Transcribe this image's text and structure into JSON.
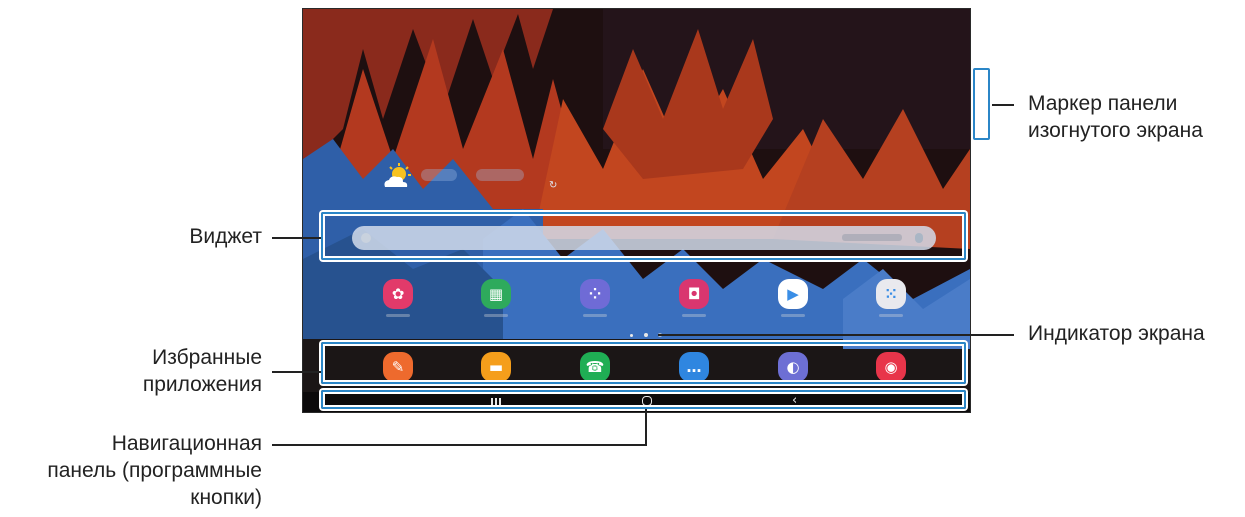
{
  "callouts": {
    "edge_handle": [
      "Маркер панели",
      "изогнутого экрана"
    ],
    "widget": "Виджет",
    "favorites": [
      "Избранные",
      "приложения"
    ],
    "page_indicator": "Индикатор экрана",
    "navbar": [
      "Навигационная",
      "панель (программные",
      "кнопки)"
    ]
  },
  "screen": {
    "weather_icon": "sun-cloud-icon",
    "refresh_icon": "↻",
    "apps": [
      {
        "name": "Galaxy Store flower",
        "icon": "flower-icon",
        "glyph": "✿",
        "color": "#e23a6a"
      },
      {
        "name": "Calendar",
        "icon": "calendar-icon",
        "glyph": "▦",
        "color": "#2eaa5c"
      },
      {
        "name": "Tools",
        "icon": "tools-icon",
        "glyph": "⁘",
        "color": "#6f6bd6"
      },
      {
        "name": "Store",
        "icon": "shopping-bag-icon",
        "glyph": "◘",
        "color": "#d9366f"
      },
      {
        "name": "Play Store",
        "icon": "play-store-icon",
        "glyph": "▶",
        "color": "#ffffff"
      },
      {
        "name": "Folder",
        "icon": "app-folder-icon",
        "glyph": "⁙",
        "color": "#e9e9ee"
      }
    ],
    "dock": [
      {
        "name": "Notes",
        "icon": "notes-icon",
        "glyph": "✎",
        "color": "#ee6a2d"
      },
      {
        "name": "My Files",
        "icon": "folder-icon",
        "glyph": "▬",
        "color": "#f59e1b"
      },
      {
        "name": "Phone",
        "icon": "phone-icon",
        "glyph": "☎",
        "color": "#1fae54"
      },
      {
        "name": "Messages",
        "icon": "messages-icon",
        "glyph": "…",
        "color": "#2f86e0"
      },
      {
        "name": "Internet",
        "icon": "internet-icon",
        "glyph": "◐",
        "color": "#6d6fd4"
      },
      {
        "name": "Camera",
        "icon": "camera-icon",
        "glyph": "◉",
        "color": "#e8354a"
      }
    ],
    "nav": {
      "back": "‹"
    }
  },
  "colors": {
    "frame": "#2b86c7",
    "text": "#222222"
  }
}
